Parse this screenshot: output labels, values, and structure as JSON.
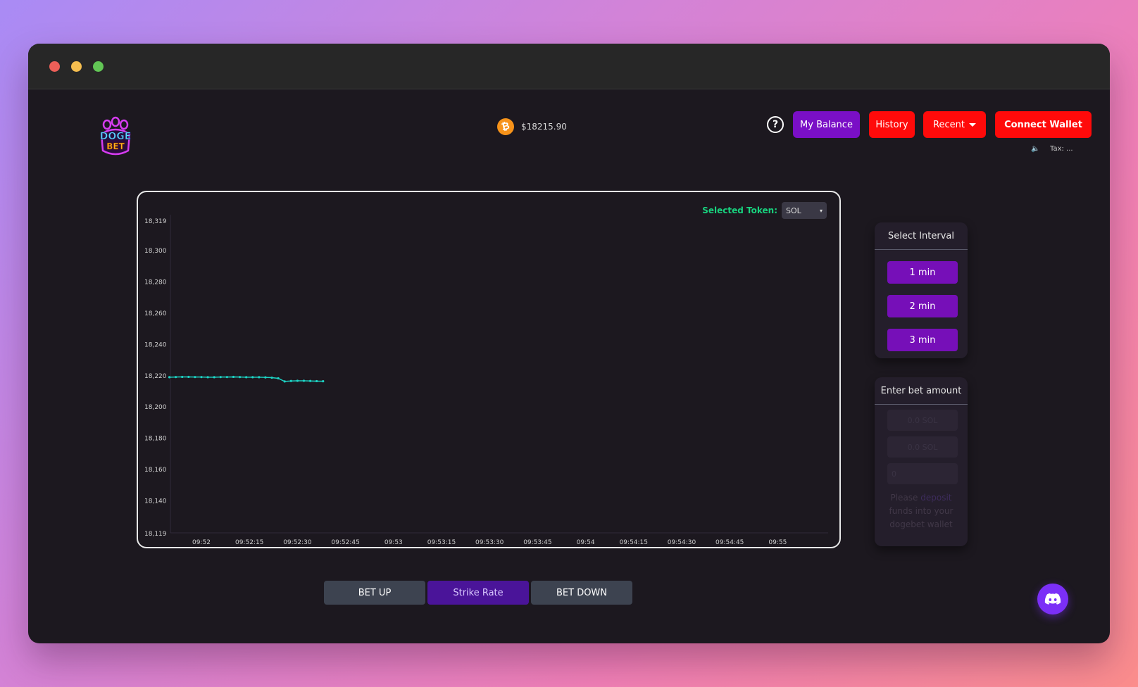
{
  "window": {
    "controls": [
      "close",
      "minimize",
      "maximize"
    ]
  },
  "header": {
    "logo_text": "DOGE BET",
    "price": "$18215.90",
    "price_icon": "bitcoin-icon",
    "help_icon": "question-circle-icon",
    "buttons": {
      "balance": "My Balance",
      "history": "History",
      "recent": "Recent",
      "connect": "Connect Wallet"
    },
    "sound_icon": "speaker-icon",
    "tax": "Tax: ..."
  },
  "token": {
    "label": "Selected Token:",
    "value": "SOL"
  },
  "chart_data": {
    "type": "line",
    "y_ticks": [
      "18,319",
      "18,300",
      "18,280",
      "18,260",
      "18,240",
      "18,220",
      "18,200",
      "18,180",
      "18,160",
      "18,140",
      "18,119"
    ],
    "x_ticks": [
      "09:52",
      "09:52:15",
      "09:52:30",
      "09:52:45",
      "09:53",
      "09:53:15",
      "09:53:30",
      "09:53:45",
      "09:54",
      "09:54:15",
      "09:54:30",
      "09:54:45",
      "09:55"
    ],
    "ylim": [
      18119,
      18319
    ],
    "series": [
      {
        "color": "#1dd3c4",
        "points": [
          [
            "09:51:50",
            18218.6
          ],
          [
            "09:51:52",
            18218.7
          ],
          [
            "09:51:54",
            18218.8
          ],
          [
            "09:51:56",
            18218.8
          ],
          [
            "09:51:58",
            18218.7
          ],
          [
            "09:52:00",
            18218.7
          ],
          [
            "09:52:02",
            18218.6
          ],
          [
            "09:52:04",
            18218.6
          ],
          [
            "09:52:06",
            18218.7
          ],
          [
            "09:52:08",
            18218.7
          ],
          [
            "09:52:10",
            18218.8
          ],
          [
            "09:52:12",
            18218.7
          ],
          [
            "09:52:14",
            18218.6
          ],
          [
            "09:52:16",
            18218.6
          ],
          [
            "09:52:18",
            18218.6
          ],
          [
            "09:52:20",
            18218.5
          ],
          [
            "09:52:22",
            18218.3
          ],
          [
            "09:52:24",
            18217.9
          ],
          [
            "09:52:26",
            18215.9
          ],
          [
            "09:52:28",
            18216.2
          ],
          [
            "09:52:30",
            18216.3
          ],
          [
            "09:52:32",
            18216.3
          ],
          [
            "09:52:34",
            18216.2
          ],
          [
            "09:52:36",
            18216.1
          ],
          [
            "09:52:38",
            18216.0
          ]
        ]
      }
    ]
  },
  "actions": {
    "bet_up": "BET UP",
    "strike": "Strike Rate",
    "bet_down": "BET DOWN"
  },
  "interval": {
    "title": "Select Interval",
    "options": [
      "1 min",
      "2 min",
      "3 min"
    ]
  },
  "bet": {
    "title": "Enter bet amount",
    "preset_1": "0.0 SOL",
    "preset_2": "0.0 SOL",
    "input_placeholder": "0",
    "note_pre": "Please ",
    "note_link": "deposit",
    "note_post": " funds into your dogebet wallet"
  },
  "discord_icon": "discord-icon"
}
